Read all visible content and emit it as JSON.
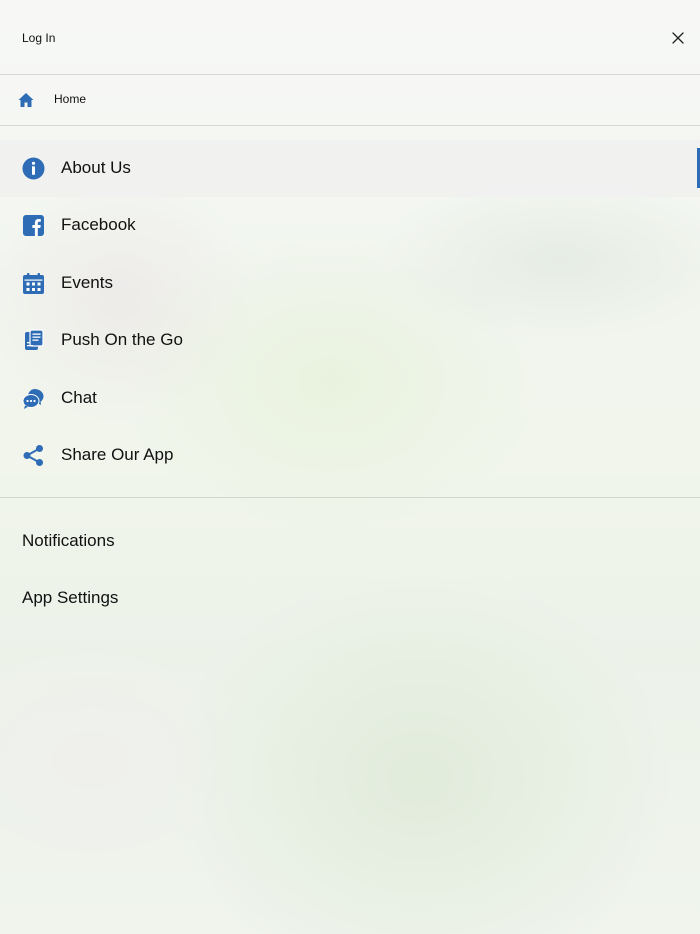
{
  "header": {
    "login_label": "Log In",
    "close_icon": "close-icon"
  },
  "home": {
    "label": "Home",
    "icon": "home-icon"
  },
  "menu_items": [
    {
      "label": "About Us",
      "icon": "info-icon",
      "active": true
    },
    {
      "label": "Facebook",
      "icon": "facebook-icon",
      "active": false
    },
    {
      "label": "Events",
      "icon": "calendar-icon",
      "active": false
    },
    {
      "label": "Push On the Go",
      "icon": "push-notes-icon",
      "active": false
    },
    {
      "label": "Chat",
      "icon": "chat-icon",
      "active": false
    },
    {
      "label": "Share Our App",
      "icon": "share-icon",
      "active": false
    }
  ],
  "secondary_items": [
    {
      "label": "Notifications"
    },
    {
      "label": "App Settings"
    }
  ],
  "colors": {
    "accent": "#2e6db6",
    "text": "#111111",
    "active_bg": "#f0f0f0"
  }
}
